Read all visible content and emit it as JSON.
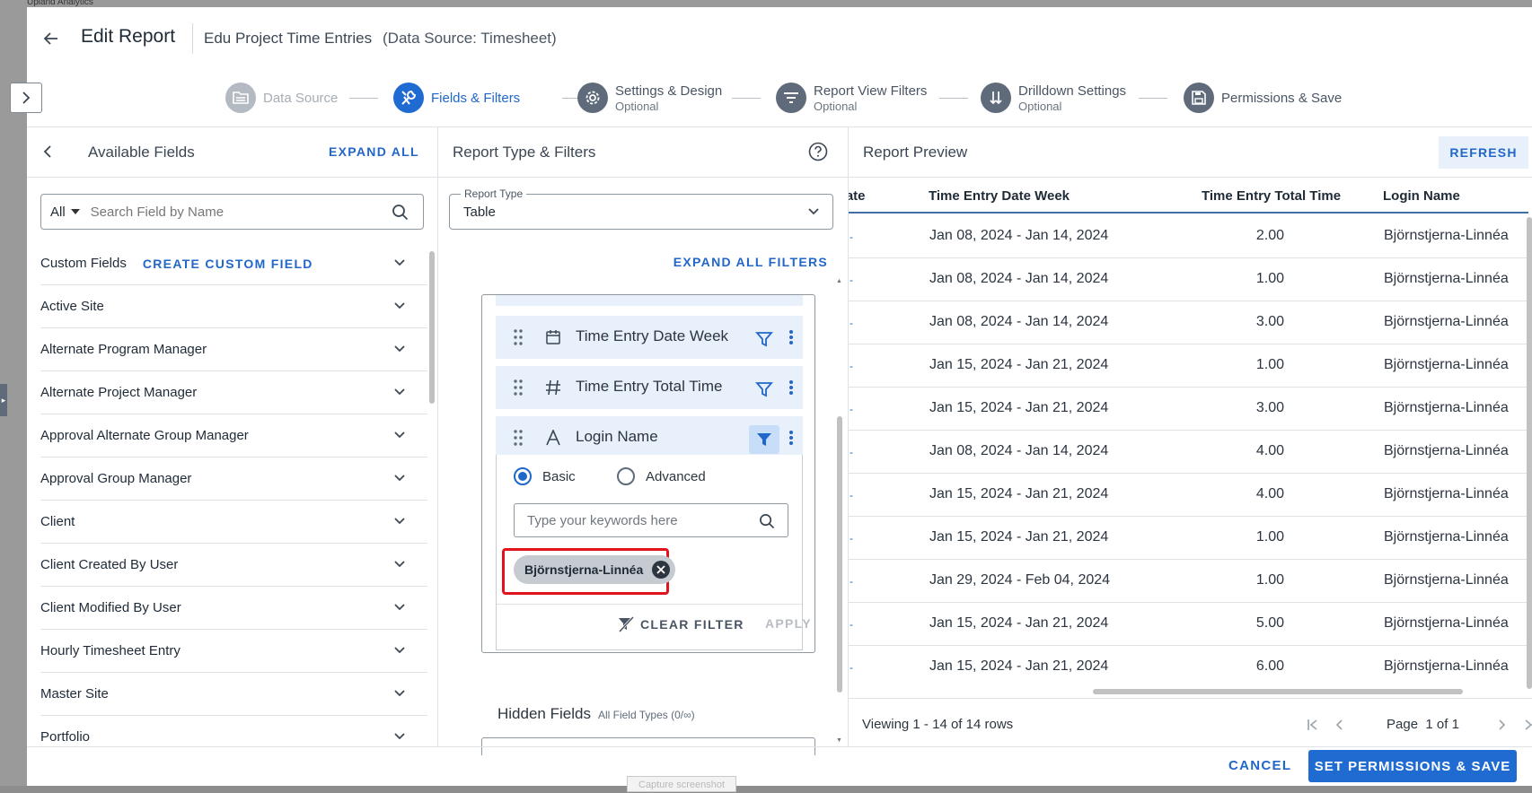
{
  "app": {
    "name": "Upland Analytics"
  },
  "header": {
    "title": "Edit Report",
    "report_name": "Edu Project Time Entries",
    "report_source": "(Data Source: Timesheet)"
  },
  "stepper": {
    "steps": [
      {
        "label": "Data Source",
        "sub": "",
        "state": "done"
      },
      {
        "label": "Fields & Filters",
        "sub": "",
        "state": "active"
      },
      {
        "label": "Settings & Design",
        "sub": "Optional",
        "state": "todo"
      },
      {
        "label": "Report View Filters",
        "sub": "Optional",
        "state": "todo"
      },
      {
        "label": "Drilldown Settings",
        "sub": "Optional",
        "state": "todo"
      },
      {
        "label": "Permissions & Save",
        "sub": "",
        "state": "todo"
      }
    ]
  },
  "left": {
    "title": "Available Fields",
    "expand_all": "EXPAND ALL",
    "search_type": "All",
    "search_placeholder": "Search Field by Name",
    "custom_fields_label": "Custom Fields",
    "create_custom_field": "CREATE CUSTOM FIELD",
    "fields": [
      "Active Site",
      "Alternate Program Manager",
      "Alternate Project Manager",
      "Approval Alternate Group Manager",
      "Approval Group Manager",
      "Client",
      "Client Created By User",
      "Client Modified By User",
      "Hourly Timesheet Entry",
      "Master Site",
      "Portfolio"
    ]
  },
  "middle": {
    "title": "Report Type & Filters",
    "report_type_legend": "Report Type",
    "report_type_value": "Table",
    "expand_all_filters": "EXPAND ALL FILTERS",
    "filter_rows": [
      {
        "label": "Time Entry Date Week",
        "type_icon": "calendar-icon",
        "filter_active": false
      },
      {
        "label": "Time Entry Total Time",
        "type_icon": "hash-icon",
        "filter_active": false
      },
      {
        "label": "Login Name",
        "type_icon": "text-type-icon",
        "filter_active": true
      }
    ],
    "filter_panel": {
      "basic_label": "Basic",
      "advanced_label": "Advanced",
      "keyword_placeholder": "Type your keywords here",
      "chip": "Björnstjerna-Linnéa",
      "clear_filter": "CLEAR FILTER",
      "apply": "APPLY"
    },
    "hidden_fields_title": "Hidden Fields",
    "hidden_fields_sub": "All Field Types (0/∞)"
  },
  "right": {
    "title": "Report Preview",
    "refresh": "REFRESH",
    "columns": [
      "Date",
      "Time Entry Date Week",
      "Time Entry Total Time",
      "Login Name"
    ],
    "rows": [
      {
        "week": "Jan 08, 2024 - Jan 14, 2024",
        "total": "2.00",
        "login": "Björnstjerna-Linnéa"
      },
      {
        "week": "Jan 08, 2024 - Jan 14, 2024",
        "total": "1.00",
        "login": "Björnstjerna-Linnéa"
      },
      {
        "week": "Jan 08, 2024 - Jan 14, 2024",
        "total": "3.00",
        "login": "Björnstjerna-Linnéa"
      },
      {
        "week": "Jan 15, 2024 - Jan 21, 2024",
        "total": "1.00",
        "login": "Björnstjerna-Linnéa"
      },
      {
        "week": "Jan 15, 2024 - Jan 21, 2024",
        "total": "3.00",
        "login": "Björnstjerna-Linnéa"
      },
      {
        "week": "Jan 08, 2024 - Jan 14, 2024",
        "total": "4.00",
        "login": "Björnstjerna-Linnéa"
      },
      {
        "week": "Jan 15, 2024 - Jan 21, 2024",
        "total": "4.00",
        "login": "Björnstjerna-Linnéa"
      },
      {
        "week": "Jan 15, 2024 - Jan 21, 2024",
        "total": "1.00",
        "login": "Björnstjerna-Linnéa"
      },
      {
        "week": "Jan 29, 2024 - Feb 04, 2024",
        "total": "1.00",
        "login": "Björnstjerna-Linnéa"
      },
      {
        "week": "Jan 15, 2024 - Jan 21, 2024",
        "total": "5.00",
        "login": "Björnstjerna-Linnéa"
      },
      {
        "week": "Jan 15, 2024 - Jan 21, 2024",
        "total": "6.00",
        "login": "Björnstjerna-Linnéa"
      }
    ],
    "viewing": "Viewing 1 - 14 of 14 rows",
    "page_label": "Page",
    "page_value": "1 of 1"
  },
  "footer": {
    "cancel": "CANCEL",
    "save": "SET PERMISSIONS & SAVE"
  },
  "capture_tag": "Capture screenshot",
  "colors": {
    "accent": "#2167c9",
    "active_bg": "#e7f0fb",
    "highlight": "#e0141e"
  }
}
